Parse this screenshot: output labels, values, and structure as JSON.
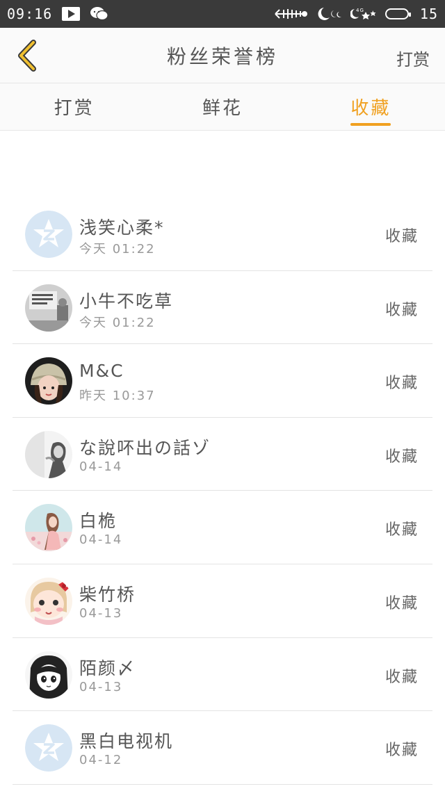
{
  "status": {
    "time": "09:16",
    "battery": "15"
  },
  "header": {
    "title": "粉丝荣誉榜",
    "right_label": "打赏"
  },
  "tabs": [
    {
      "label": "打赏",
      "active": false
    },
    {
      "label": "鲜花",
      "active": false
    },
    {
      "label": "收藏",
      "active": true
    }
  ],
  "list": [
    {
      "name": "浅笑心柔*",
      "time": "今天 01:22",
      "action": "收藏",
      "avatar": "default-star"
    },
    {
      "name": "小牛不吃草",
      "time": "今天 01:22",
      "action": "收藏",
      "avatar": "photo-gray"
    },
    {
      "name": "M&C",
      "time": "昨天 10:37",
      "action": "收藏",
      "avatar": "photo-girl-hat"
    },
    {
      "name": "な說吥出の話ゾ",
      "time": "04-14",
      "action": "收藏",
      "avatar": "photo-bw-girl"
    },
    {
      "name": "白桅",
      "time": "04-14",
      "action": "收藏",
      "avatar": "photo-pastel-girl"
    },
    {
      "name": "柴竹桥",
      "time": "04-13",
      "action": "收藏",
      "avatar": "cartoon-girl-bow"
    },
    {
      "name": "陌颜〆",
      "time": "04-13",
      "action": "收藏",
      "avatar": "manga-girl"
    },
    {
      "name": "黑白电视机",
      "time": "04-12",
      "action": "收藏",
      "avatar": "default-star"
    }
  ],
  "colors": {
    "accent": "#f0a020",
    "statusbar": "#3a3a3a"
  }
}
